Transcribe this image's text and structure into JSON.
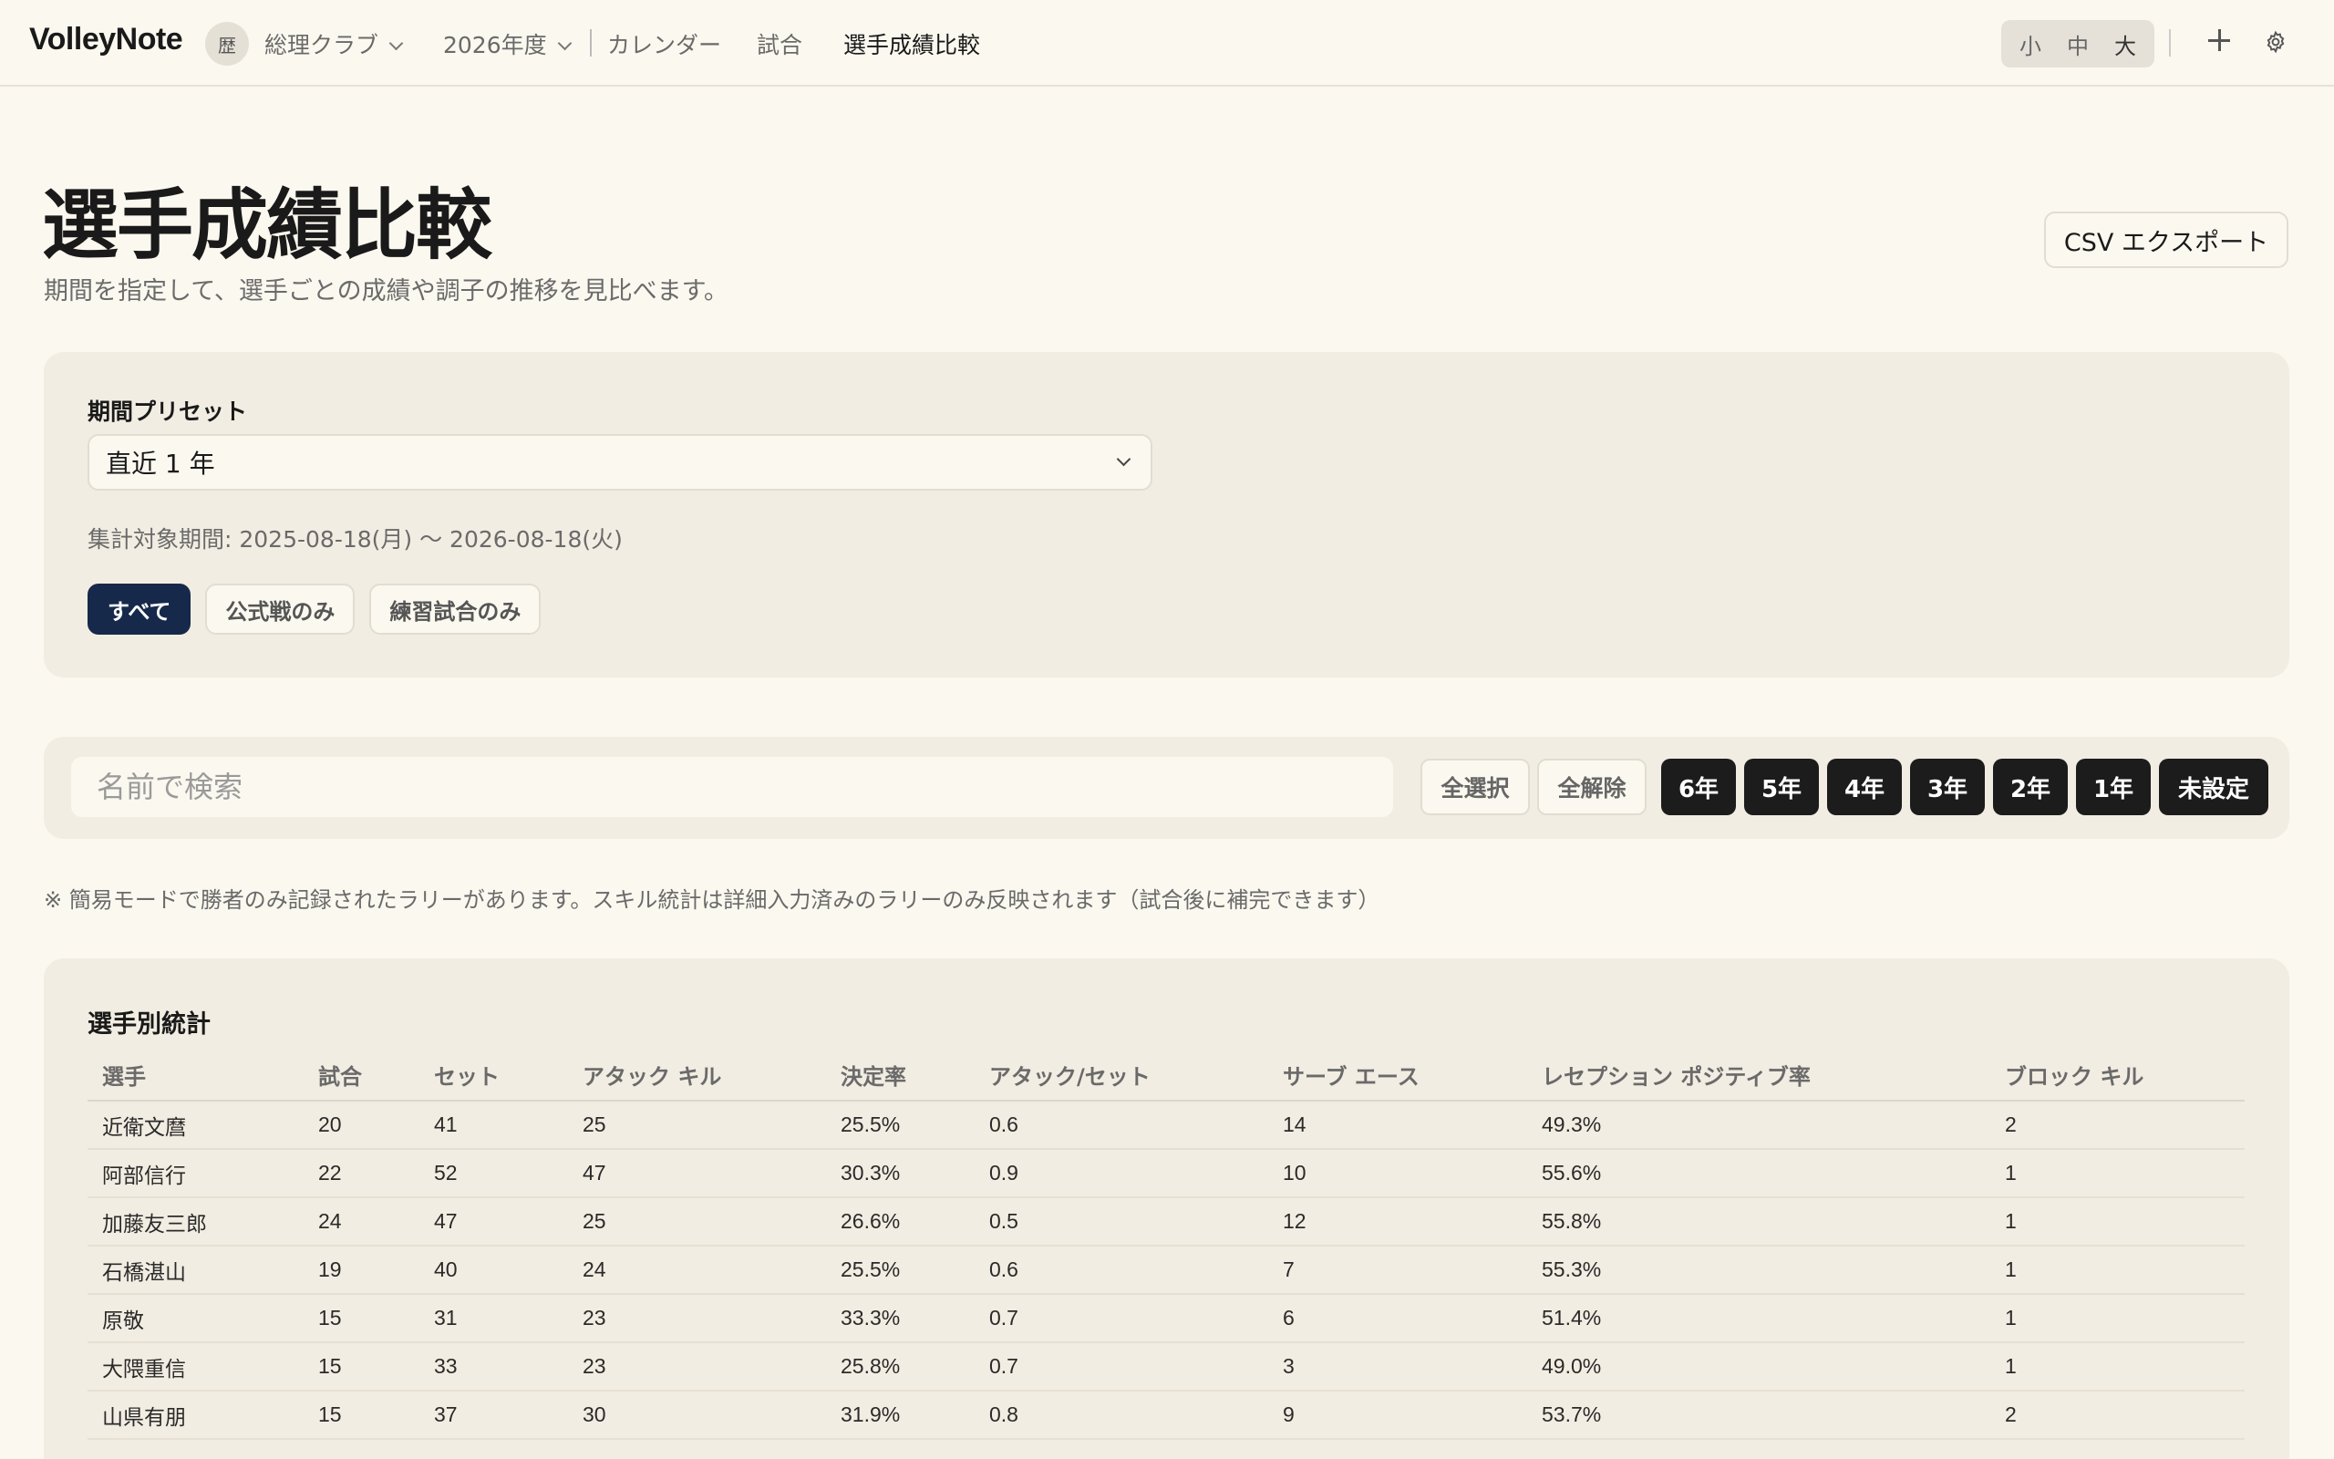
{
  "header": {
    "brand": "VolleyNote",
    "club_avatar": "歴",
    "club_name": "総理クラブ",
    "season": "2026年度",
    "nav": [
      "カレンダー",
      "試合",
      "選手成績比較"
    ],
    "active_nav": "選手成績比較",
    "text_sizes": [
      "小",
      "中",
      "大"
    ]
  },
  "page": {
    "title": "選手成績比較",
    "subtitle": "期間を指定して、選手ごとの成績や調子の推移を見比べます。",
    "csv_label": "CSV エクスポート"
  },
  "period": {
    "preset_label": "期間プリセット",
    "preset_value": "直近 1 年",
    "range_text": "集計対象期間: 2025-08-18(月) 〜 2026-08-18(火)",
    "filters": [
      "すべて",
      "公式戦のみ",
      "練習試合のみ"
    ],
    "active_filter": "すべて"
  },
  "search": {
    "placeholder": "名前で検索",
    "select_all": "全選択",
    "clear_all": "全解除",
    "grades": [
      "6年",
      "5年",
      "4年",
      "3年",
      "2年",
      "1年",
      "未設定"
    ]
  },
  "note": "※ 簡易モードで勝者のみ記録されたラリーがあります。スキル統計は詳細入力済みのラリーのみ反映されます（試合後に補完できます）",
  "stats": {
    "title": "選手別統計",
    "columns": [
      "選手",
      "試合",
      "セット",
      "アタック キル",
      "決定率",
      "アタック/セット",
      "サーブ エース",
      "レセプション ポジティブ率",
      "ブロック キル"
    ],
    "rows": [
      [
        "近衛文麿",
        "20",
        "41",
        "25",
        "25.5%",
        "0.6",
        "14",
        "49.3%",
        "2"
      ],
      [
        "阿部信行",
        "22",
        "52",
        "47",
        "30.3%",
        "0.9",
        "10",
        "55.6%",
        "1"
      ],
      [
        "加藤友三郎",
        "24",
        "47",
        "25",
        "26.6%",
        "0.5",
        "12",
        "55.8%",
        "1"
      ],
      [
        "石橋湛山",
        "19",
        "40",
        "24",
        "25.5%",
        "0.6",
        "7",
        "55.3%",
        "1"
      ],
      [
        "原敬",
        "15",
        "31",
        "23",
        "33.3%",
        "0.7",
        "6",
        "51.4%",
        "1"
      ],
      [
        "大隈重信",
        "15",
        "33",
        "23",
        "25.8%",
        "0.7",
        "3",
        "49.0%",
        "1"
      ],
      [
        "山県有朋",
        "15",
        "37",
        "30",
        "31.9%",
        "0.8",
        "9",
        "53.7%",
        "2"
      ]
    ]
  }
}
